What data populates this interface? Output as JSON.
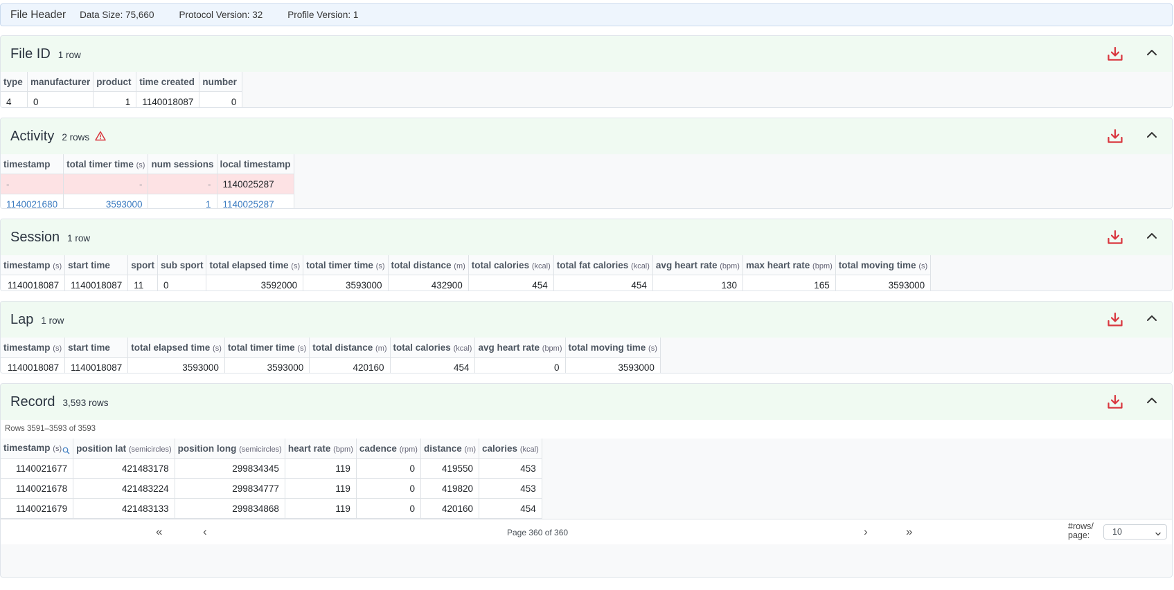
{
  "file_header": {
    "title": "File Header",
    "data_size": "Data Size: 75,660",
    "protocol_version": "Protocol Version: 32",
    "profile_version": "Profile Version: 1"
  },
  "file_id": {
    "title": "File ID",
    "count": "1 row",
    "cols": {
      "type": "type",
      "manufacturer": "manufacturer",
      "product": "product",
      "time_created": "time created",
      "number": "number"
    },
    "row": {
      "type": "4",
      "manufacturer": "0",
      "product": "1",
      "time_created": "1140018087",
      "number": "0"
    }
  },
  "activity": {
    "title": "Activity",
    "count": "2 rows",
    "cols": {
      "timestamp": "timestamp",
      "total_timer_time": "total timer time",
      "total_timer_time_unit": "(s)",
      "num_sessions": "num sessions",
      "local_timestamp": "local timestamp"
    },
    "rows": [
      {
        "timestamp": "-",
        "total_timer_time": "-",
        "num_sessions": "-",
        "local_timestamp": "1140025287"
      },
      {
        "timestamp": "1140021680",
        "total_timer_time": "3593000",
        "num_sessions": "1",
        "local_timestamp": "1140025287"
      }
    ]
  },
  "session": {
    "title": "Session",
    "count": "1 row",
    "cols": {
      "timestamp": "timestamp",
      "timestamp_unit": "(s)",
      "start_time": "start time",
      "sport": "sport",
      "sub_sport": "sub sport",
      "total_elapsed_time": "total elapsed time",
      "total_elapsed_time_unit": "(s)",
      "total_timer_time": "total timer time",
      "total_timer_time_unit": "(s)",
      "total_distance": "total distance",
      "total_distance_unit": "(m)",
      "total_calories": "total calories",
      "total_calories_unit": "(kcal)",
      "total_fat_calories": "total fat calories",
      "total_fat_calories_unit": "(kcal)",
      "avg_heart_rate": "avg heart rate",
      "avg_heart_rate_unit": "(bpm)",
      "max_heart_rate": "max heart rate",
      "max_heart_rate_unit": "(bpm)",
      "total_moving_time": "total moving time",
      "total_moving_time_unit": "(s)"
    },
    "row": {
      "timestamp": "1140018087",
      "start_time": "1140018087",
      "sport": "11",
      "sub_sport": "0",
      "total_elapsed_time": "3592000",
      "total_timer_time": "3593000",
      "total_distance": "432900",
      "total_calories": "454",
      "total_fat_calories": "454",
      "avg_heart_rate": "130",
      "max_heart_rate": "165",
      "total_moving_time": "3593000"
    }
  },
  "lap": {
    "title": "Lap",
    "count": "1 row",
    "cols": {
      "timestamp": "timestamp",
      "timestamp_unit": "(s)",
      "start_time": "start time",
      "total_elapsed_time": "total elapsed time",
      "total_elapsed_time_unit": "(s)",
      "total_timer_time": "total timer time",
      "total_timer_time_unit": "(s)",
      "total_distance": "total distance",
      "total_distance_unit": "(m)",
      "total_calories": "total calories",
      "total_calories_unit": "(kcal)",
      "avg_heart_rate": "avg heart rate",
      "avg_heart_rate_unit": "(bpm)",
      "total_moving_time": "total moving time",
      "total_moving_time_unit": "(s)"
    },
    "row": {
      "timestamp": "1140018087",
      "start_time": "1140018087",
      "total_elapsed_time": "3593000",
      "total_timer_time": "3593000",
      "total_distance": "420160",
      "total_calories": "454",
      "avg_heart_rate": "0",
      "total_moving_time": "3593000"
    }
  },
  "record": {
    "title": "Record",
    "count": "3,593 rows",
    "rows_info": "Rows 3591–3593 of 3593",
    "cols": {
      "timestamp": "timestamp",
      "timestamp_unit": "(s)",
      "position_lat": "position lat",
      "position_lat_unit": "(semicircles)",
      "position_long": "position long",
      "position_long_unit": "(semicircles)",
      "heart_rate": "heart rate",
      "heart_rate_unit": "(bpm)",
      "cadence": "cadence",
      "cadence_unit": "(rpm)",
      "distance": "distance",
      "distance_unit": "(m)",
      "calories": "calories",
      "calories_unit": "(kcal)"
    },
    "rows": [
      {
        "timestamp": "1140021677",
        "position_lat": "421483178",
        "position_long": "299834345",
        "heart_rate": "119",
        "cadence": "0",
        "distance": "419550",
        "calories": "453"
      },
      {
        "timestamp": "1140021678",
        "position_lat": "421483224",
        "position_long": "299834777",
        "heart_rate": "119",
        "cadence": "0",
        "distance": "419820",
        "calories": "453"
      },
      {
        "timestamp": "1140021679",
        "position_lat": "421483133",
        "position_long": "299834868",
        "heart_rate": "119",
        "cadence": "0",
        "distance": "420160",
        "calories": "454"
      }
    ],
    "pager": {
      "first": "«",
      "prev": "‹",
      "next": "›",
      "last": "»",
      "page_info": "Page 360 of 360",
      "rows_per_page_label_1": "#rows/",
      "rows_per_page_label_2": "page:",
      "rows_per_page_value": "10"
    }
  },
  "icons": {
    "download": "download-icon",
    "collapse": "chevron-up-icon",
    "warning": "warning-triangle-icon",
    "search": "search-icon",
    "select": "chevron-down-icon"
  },
  "colors": {
    "header_bg": "#f0faf2",
    "download_icon": "#d9363e",
    "warning_icon": "#d9363e",
    "link_text": "#3b7bc0",
    "error_row": "#fde2e4",
    "file_header_bg": "#eef5fd"
  }
}
